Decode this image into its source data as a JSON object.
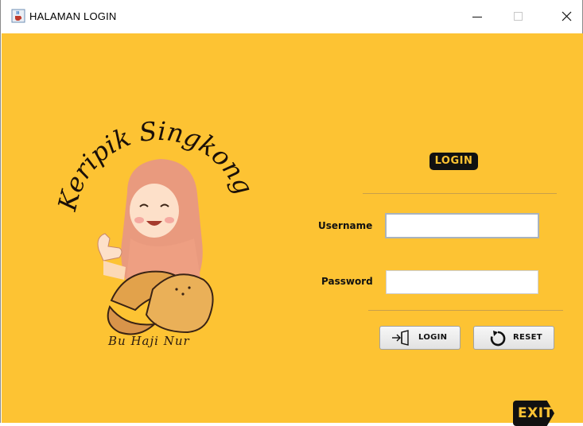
{
  "window": {
    "title": "HALAMAN LOGIN",
    "icon": "java-cup-icon",
    "controls": [
      "minimize-icon",
      "maximize-icon",
      "close-icon"
    ]
  },
  "colors": {
    "background": "#fdc333",
    "badge": "#111111",
    "badge_text": "#fdc333"
  },
  "logo": {
    "brand_text": "Keripik Singkong",
    "signature": "Bu Haji Nur"
  },
  "form": {
    "heading": "LOGIN",
    "username_label": "Username",
    "username_value": "",
    "password_label": "Password",
    "password_value": ""
  },
  "buttons": {
    "login_label": "LOGIN",
    "login_icon": "enter-door-icon",
    "reset_label": "RESET",
    "reset_icon": "reset-arrow-icon",
    "exit_label": "EXIT"
  }
}
